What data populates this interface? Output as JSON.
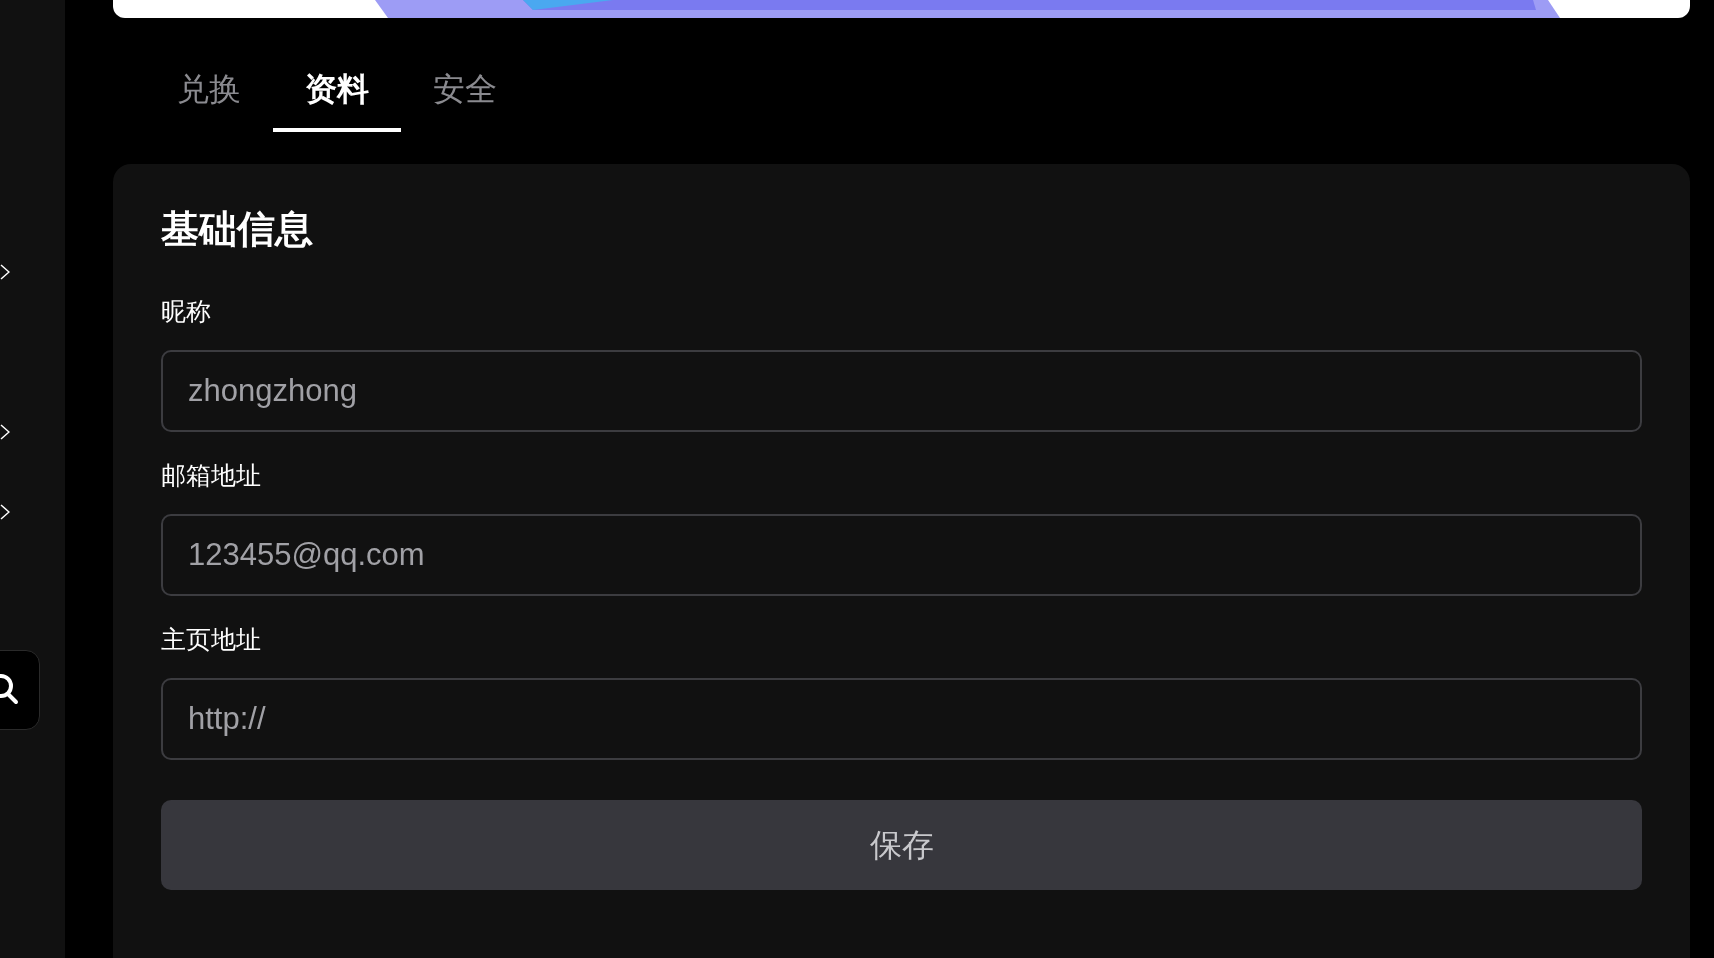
{
  "tabs": [
    {
      "label": "兑换",
      "selected": false
    },
    {
      "label": "资料",
      "selected": true
    },
    {
      "label": "安全",
      "selected": false
    }
  ],
  "card": {
    "title": "基础信息",
    "fields": [
      {
        "label": "昵称",
        "value": "zhongzhong"
      },
      {
        "label": "邮箱地址",
        "value": "123455@qq.com"
      },
      {
        "label": "主页地址",
        "value": "http://"
      }
    ],
    "button": "保存"
  }
}
